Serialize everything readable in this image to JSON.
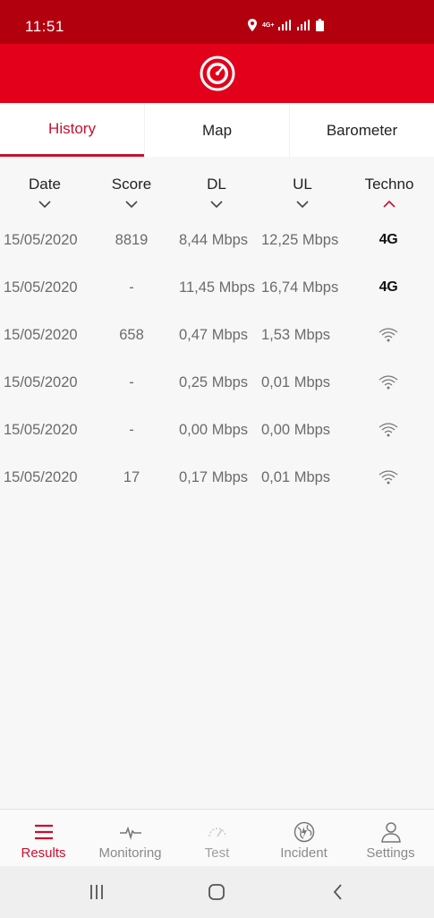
{
  "status_bar": {
    "time": "11:51",
    "network": "4G+",
    "icons": [
      "location-icon",
      "signal-icon",
      "signal-icon",
      "battery-icon"
    ]
  },
  "header": {
    "logo": "speedometer-logo"
  },
  "tabs": [
    {
      "label": "History",
      "active": true
    },
    {
      "label": "Map",
      "active": false
    },
    {
      "label": "Barometer",
      "active": false
    }
  ],
  "columns": [
    {
      "label": "Date",
      "sort": "down"
    },
    {
      "label": "Score",
      "sort": "down"
    },
    {
      "label": "DL",
      "sort": "down"
    },
    {
      "label": "UL",
      "sort": "down"
    },
    {
      "label": "Techno",
      "sort": "up"
    }
  ],
  "rows": [
    {
      "date": "15/05/2020",
      "score": "8819",
      "dl": "8,44 Mbps",
      "ul": "12,25 Mbps",
      "techno": "4G"
    },
    {
      "date": "15/05/2020",
      "score": "-",
      "dl": "11,45 Mbps",
      "ul": "16,74 Mbps",
      "techno": "4G"
    },
    {
      "date": "15/05/2020",
      "score": "658",
      "dl": "0,47 Mbps",
      "ul": "1,53 Mbps",
      "techno": "wifi-icon"
    },
    {
      "date": "15/05/2020",
      "score": "-",
      "dl": "0,25 Mbps",
      "ul": "0,01 Mbps",
      "techno": "wifi-icon"
    },
    {
      "date": "15/05/2020",
      "score": "-",
      "dl": "0,00 Mbps",
      "ul": "0,00 Mbps",
      "techno": "wifi-icon"
    },
    {
      "date": "15/05/2020",
      "score": "17",
      "dl": "0,17 Mbps",
      "ul": "0,01 Mbps",
      "techno": "wifi-icon"
    }
  ],
  "bottom_nav": [
    {
      "label": "Results",
      "icon": "menu-icon",
      "active": true
    },
    {
      "label": "Monitoring",
      "icon": "pulse-icon",
      "active": false
    },
    {
      "label": "Test",
      "icon": "speed-icon",
      "active": false
    },
    {
      "label": "Incident",
      "icon": "globe-alert-icon",
      "active": false
    },
    {
      "label": "Settings",
      "icon": "user-icon",
      "active": false
    }
  ],
  "colors": {
    "status_bar": "#b3000f",
    "header": "#e2001a",
    "accent": "#c8102e",
    "text_muted": "#6b6b6b"
  }
}
